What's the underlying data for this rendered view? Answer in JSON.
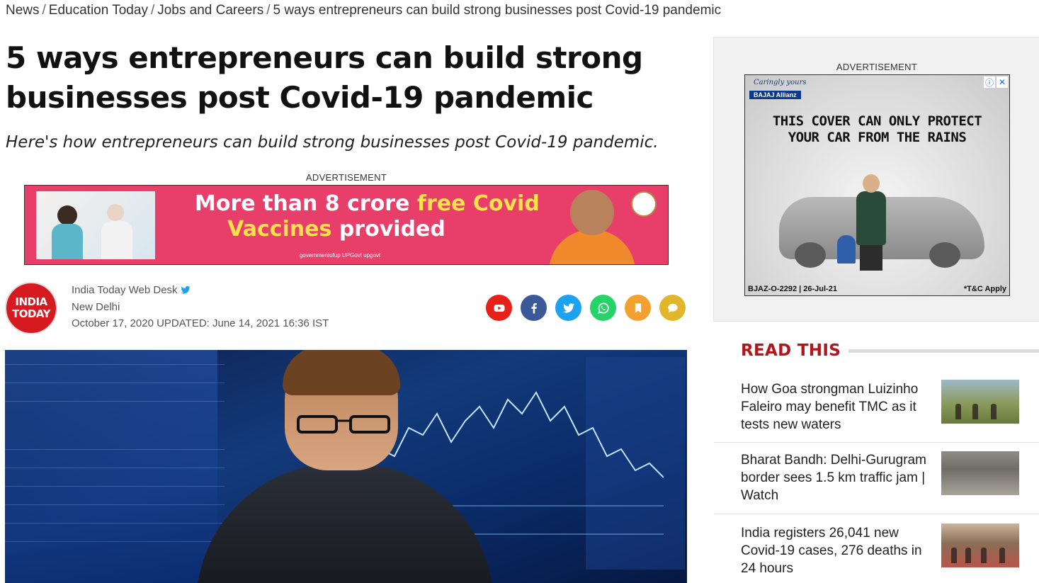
{
  "breadcrumb": {
    "items": [
      "News",
      "Education Today",
      "Jobs and Careers",
      "5 ways entrepreneurs can build strong businesses post Covid-19 pandemic"
    ],
    "separator": "/"
  },
  "article": {
    "title": "5 ways entrepreneurs can build strong businesses post Covid-19 pandemic",
    "subtitle": "Here's how entrepreneurs can build strong businesses post Covid-19 pandemic.",
    "ad_label": "ADVERTISEMENT",
    "author": {
      "logo_line1": "INDIA",
      "logo_line2": "TODAY",
      "name": "India Today Web Desk",
      "location": "New Delhi",
      "published": "October 17, 2020",
      "updated_label": "UPDATED:",
      "updated": "June 14, 2021 16:36 IST"
    },
    "share_icons": [
      {
        "name": "youtube-icon",
        "color": "#e62117"
      },
      {
        "name": "facebook-icon",
        "color": "#3b5998"
      },
      {
        "name": "twitter-icon",
        "color": "#1da1f2"
      },
      {
        "name": "whatsapp-icon",
        "color": "#25d366"
      },
      {
        "name": "bookmark-icon",
        "color": "#f2a12e"
      },
      {
        "name": "comment-icon",
        "color": "#e2b62a"
      }
    ]
  },
  "banner_ad": {
    "line1_a": "More than 8 crore ",
    "line1_b": "free Covid",
    "line2_a": "Vaccines",
    "line2_b": " provided",
    "social": "governmentofup   UPGovt   upgovt"
  },
  "sidebar": {
    "ad_label": "ADVERTISEMENT",
    "ad": {
      "brand_tagline": "Caringly yours",
      "brand": "BAJAJ Allianz",
      "text_line1": "THIS COVER CAN ONLY PROTECT",
      "text_line2": "YOUR CAR FROM THE RAINS",
      "code": "BJAZ-O-2292 | 26-Jul-21",
      "terms": "*T&C Apply",
      "info_glyph": "ⓘ",
      "close_glyph": "✕"
    },
    "read_this": {
      "title": "READ THIS",
      "stories": [
        {
          "title": "How Goa strongman Luizinho Faleiro may benefit TMC as it tests new waters"
        },
        {
          "title": "Bharat Bandh: Delhi-Gurugram border sees 1.5 km traffic jam | Watch"
        },
        {
          "title": "India registers 26,041 new Covid-19 cases, 276 deaths in 24 hours"
        }
      ]
    }
  }
}
